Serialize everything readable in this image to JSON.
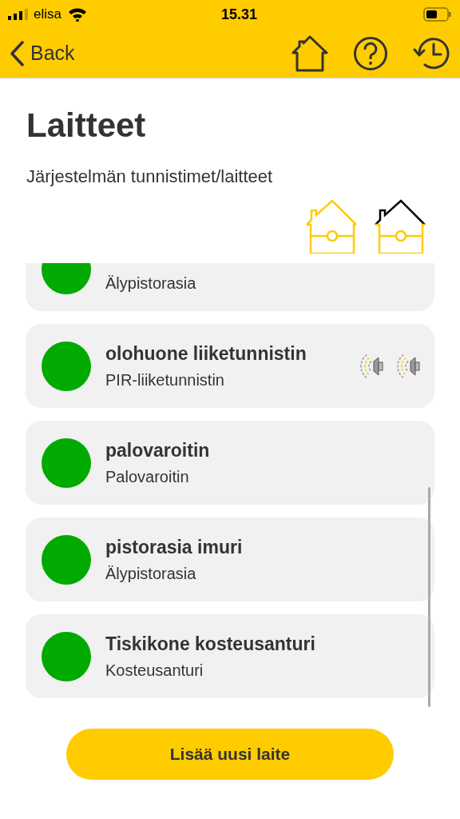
{
  "status_bar": {
    "carrier": "elisa",
    "time": "15.31"
  },
  "nav": {
    "back": "Back"
  },
  "title": "Laitteet",
  "subtitle": "Järjestelmän tunnistimet/laitteet",
  "house_views": [
    {
      "roof_highlighted": false
    },
    {
      "roof_highlighted": true
    }
  ],
  "devices": [
    {
      "type": "Älypistorasia",
      "color": "#00aa00",
      "clipped": true
    },
    {
      "name": "olohuone liiketunnistin",
      "type": "PIR-liiketunnistin",
      "color": "#00aa00",
      "clipped": false,
      "indicators": [
        {
          "kind": "sound"
        },
        {
          "kind": "sound"
        }
      ]
    },
    {
      "name": "palovaroitin",
      "type": "Palovaroitin",
      "color": "#00aa00",
      "clipped": false
    },
    {
      "name": "pistorasia imuri",
      "type": "Älypistorasia",
      "color": "#00aa00",
      "clipped": false
    },
    {
      "name": "Tiskikone kosteusanturi",
      "type": "Kosteusanturi",
      "color": "#00aa00",
      "clipped": false
    }
  ],
  "add_button": "Lisää uusi laite"
}
